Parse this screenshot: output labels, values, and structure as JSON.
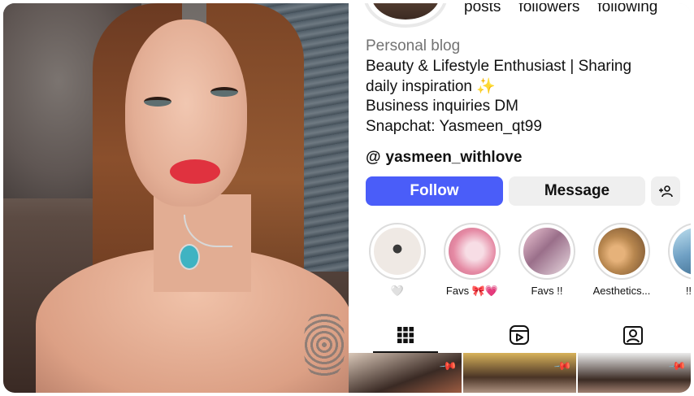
{
  "profile": {
    "stats_partial": [
      "posts",
      "followers",
      "following"
    ],
    "category": "Personal blog",
    "bio_lines": [
      "Beauty & Lifestyle Enthusiast | Sharing",
      "daily inspiration ✨",
      "Business inquiries DM",
      "Snapchat: Yasmeen_qt99"
    ],
    "threads_handle": "yasmeen_withlove",
    "threads_icon": "@"
  },
  "actions": {
    "follow_label": "Follow",
    "message_label": "Message",
    "add_user_icon": "+👤"
  },
  "highlights": [
    {
      "label": "🤍",
      "thumb_color": "#d9d2cc"
    },
    {
      "label": "Favs 🎀💗",
      "thumb_color": "#f2b8c6"
    },
    {
      "label": "Favs !!",
      "thumb_color": "#c9a4b8"
    },
    {
      "label": "Aesthetics...",
      "thumb_color": "#b8874f"
    },
    {
      "label": "!! هم",
      "thumb_color": "#6fa0c4"
    }
  ],
  "tabs": [
    {
      "name": "grid",
      "icon": "grid-icon"
    },
    {
      "name": "reels",
      "icon": "reels-icon"
    },
    {
      "name": "tagged",
      "icon": "tagged-icon"
    }
  ],
  "colors": {
    "follow_blue": "#4a5df9",
    "secondary_button": "#efefef",
    "muted_text": "#737373"
  }
}
